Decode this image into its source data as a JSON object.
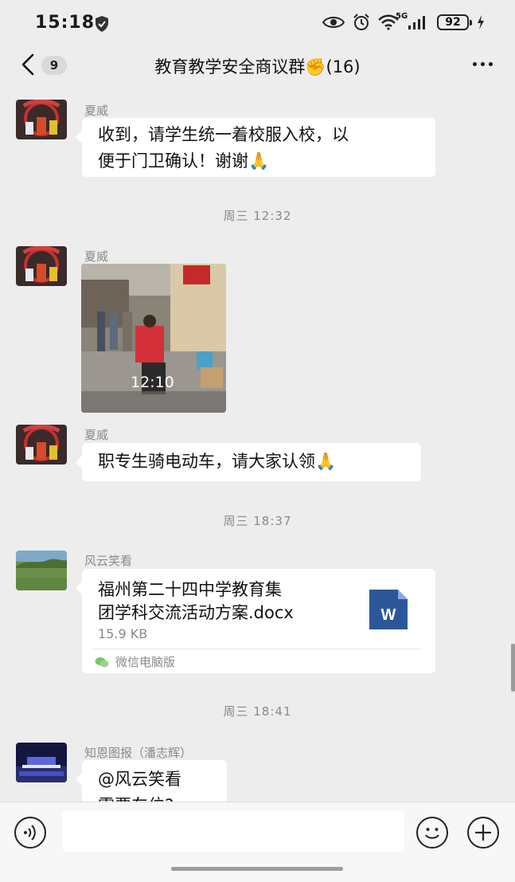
{
  "status_bar": {
    "time": "15:18",
    "network": "5G",
    "battery": "92"
  },
  "header": {
    "unread_count": "9",
    "title": "教育教学安全商议群✊(16)"
  },
  "messages": [
    {
      "sender": "夏威",
      "lines": [
        "收到，请学生统一着校服入校，以",
        "便于门卫确认！谢谢🙏"
      ]
    },
    {
      "timestamp": "周三 12:32"
    },
    {
      "sender": "夏威",
      "photo_caption": "12:10"
    },
    {
      "sender": "夏威",
      "text": "职专生骑电动车，请大家认领🙏"
    },
    {
      "timestamp": "周三 18:37"
    },
    {
      "sender": "风云笑看",
      "file": {
        "name_lines": [
          "福州第二十四中学教育集",
          "团学科交流活动方案.docx"
        ],
        "size": "15.9 KB",
        "source": "微信电脑版",
        "icon_letter": "W"
      }
    },
    {
      "timestamp": "周三 18:41"
    },
    {
      "sender": "知恩图报（潘志辉）",
      "lines": [
        "@风云笑看",
        "需要车位?"
      ]
    }
  ],
  "colors": {
    "background": "#ededed",
    "bubble": "#ffffff",
    "word_blue": "#2b579a"
  },
  "icons": [
    "voice-icon",
    "emoji-icon",
    "plus-icon",
    "back-arrow-icon",
    "more-icon"
  ]
}
